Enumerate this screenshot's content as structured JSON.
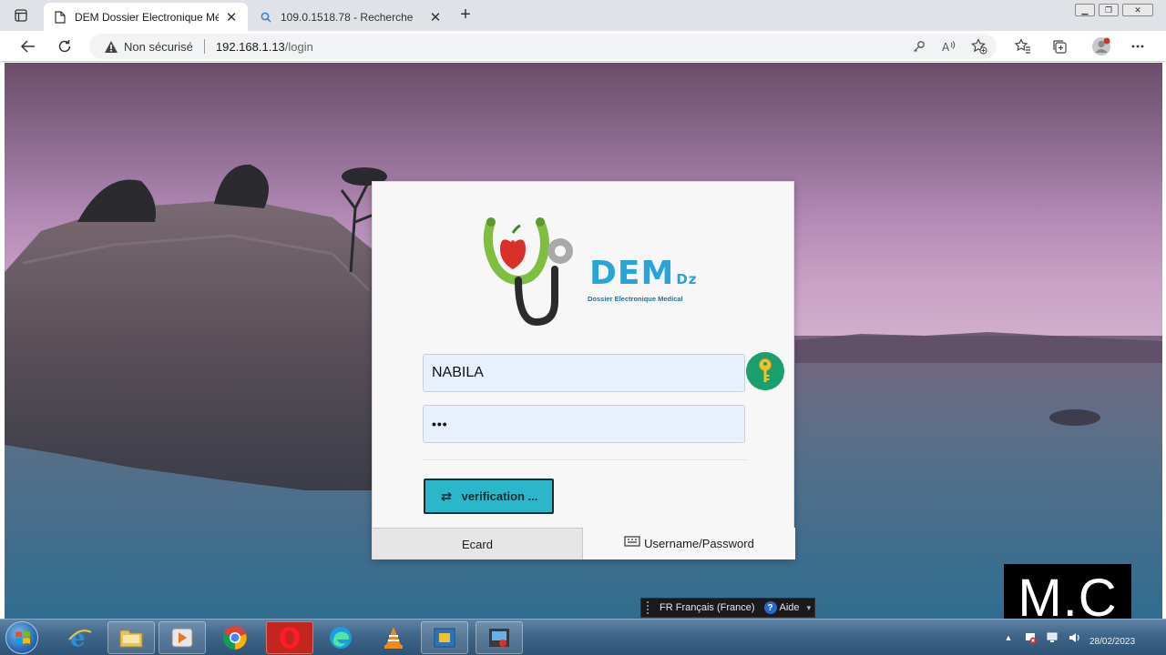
{
  "browser": {
    "tabs": [
      {
        "title": "DEM Dossier Electronique Médic",
        "icon": "page-icon",
        "active": true
      },
      {
        "title": "109.0.1518.78 - Recherche",
        "icon": "search-icon",
        "active": false
      }
    ],
    "new_tab_label": "+",
    "address": {
      "security_label": "Non sécurisé",
      "host": "192.168.1.13",
      "path": "/login"
    }
  },
  "login": {
    "brand": {
      "name": "DEM",
      "suffix": "Dz",
      "subtitle": "Dossier Electronique Medical"
    },
    "username_value": "NABILA",
    "password_mask": "•••",
    "verify_label": "verification ...",
    "tabs": {
      "ecard": "Ecard",
      "userpass": "Username/Password"
    }
  },
  "language_bar": {
    "language": "FR Français (France)",
    "help": "Aide"
  },
  "watermark": "M.C",
  "taskbar": {
    "date": "28/02/2023",
    "apps": [
      "internet-explorer-icon",
      "file-explorer-icon",
      "media-player-icon",
      "chrome-icon",
      "opera-icon",
      "edge-icon",
      "vlc-icon",
      "virtualbox-icon",
      "movie-maker-icon"
    ]
  },
  "colors": {
    "brand_blue": "#29a3d8",
    "key_green": "#1a9f6e",
    "verify_teal": "#2ab7ca",
    "input_bg": "#e8f0fe"
  }
}
